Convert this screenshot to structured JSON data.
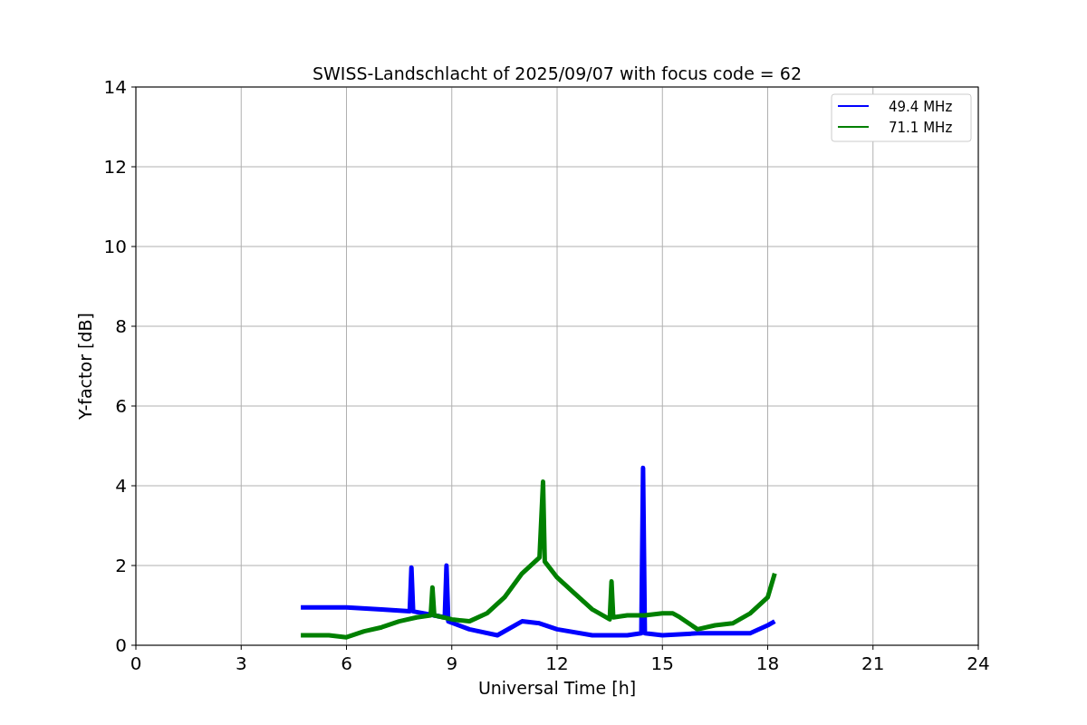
{
  "figure": {
    "chart_data": {
      "type": "line",
      "title": "SWISS-Landschlacht of 2025/09/07 with focus code = 62",
      "xlabel": "Universal Time [h]",
      "ylabel": "Y-factor [dB]",
      "xlim": [
        0,
        24
      ],
      "ylim": [
        0,
        14
      ],
      "xticks": [
        0,
        3,
        6,
        9,
        12,
        15,
        18,
        21,
        24
      ],
      "yticks": [
        0,
        2,
        4,
        6,
        8,
        10,
        12,
        14
      ],
      "grid": true,
      "legend": true,
      "series": [
        {
          "name": "49.4 MHz",
          "color": "#0000ff",
          "x": [
            4.7,
            5.5,
            6,
            7,
            7.8,
            7.85,
            7.9,
            8.5,
            8.8,
            8.85,
            8.9,
            9.5,
            10.3,
            11,
            11.5,
            12,
            13,
            14,
            14.4,
            14.45,
            14.5,
            15,
            16,
            17,
            17.5,
            18,
            18.2
          ],
          "values": [
            0.95,
            0.95,
            0.95,
            0.9,
            0.85,
            1.95,
            0.85,
            0.75,
            0.7,
            2.0,
            0.6,
            0.4,
            0.25,
            0.6,
            0.55,
            0.4,
            0.25,
            0.25,
            0.3,
            4.45,
            0.3,
            0.25,
            0.3,
            0.3,
            0.3,
            0.5,
            0.6
          ]
        },
        {
          "name": "71.1 MHz",
          "color": "#008000",
          "x": [
            4.7,
            5.5,
            6,
            6.5,
            7,
            7.5,
            8,
            8.4,
            8.45,
            8.5,
            9,
            9.5,
            10,
            10.5,
            11,
            11.5,
            11.6,
            11.65,
            12,
            12.5,
            13,
            13.5,
            13.55,
            13.6,
            14,
            14.5,
            15,
            15.3,
            15.5,
            16,
            16.5,
            17,
            17.5,
            18,
            18.2
          ],
          "values": [
            0.25,
            0.25,
            0.2,
            0.35,
            0.45,
            0.6,
            0.7,
            0.75,
            1.45,
            0.75,
            0.65,
            0.6,
            0.8,
            1.2,
            1.8,
            2.2,
            4.1,
            2.1,
            1.7,
            1.3,
            0.9,
            0.65,
            1.6,
            0.7,
            0.75,
            0.75,
            0.8,
            0.8,
            0.7,
            0.4,
            0.5,
            0.55,
            0.8,
            1.2,
            1.8
          ]
        }
      ]
    }
  }
}
